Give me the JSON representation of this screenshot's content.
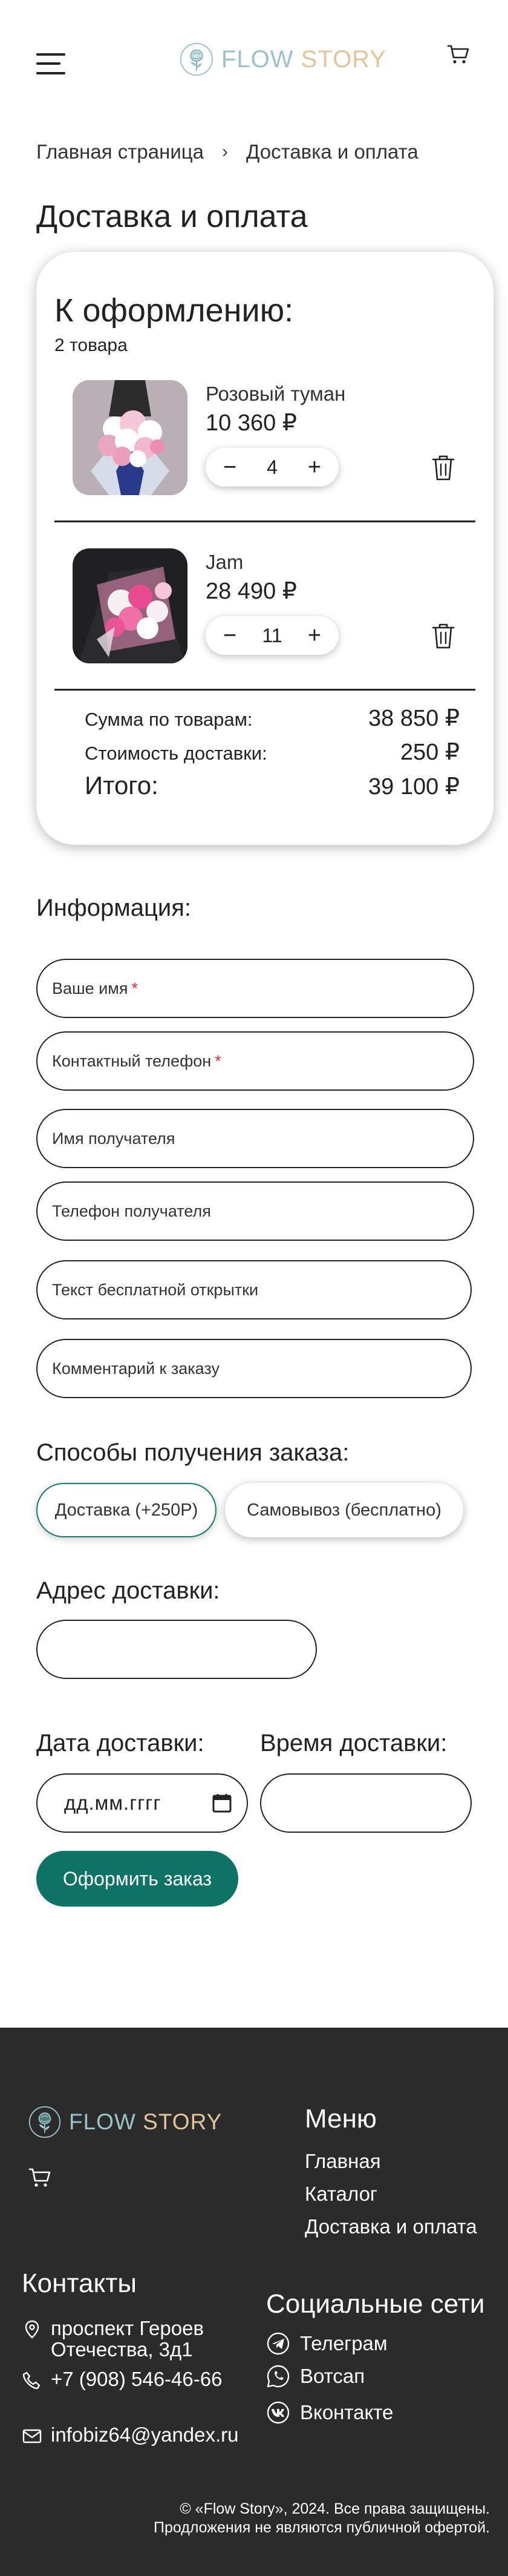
{
  "header": {
    "logo_word1": "FLOW",
    "logo_word2": "STORY"
  },
  "breadcrumb": {
    "home": "Главная страница",
    "separator": "›",
    "current": "Доставка и оплата"
  },
  "page_title": "Доставка и оплата",
  "cart": {
    "title": "К оформлению:",
    "count_label": "2 товара",
    "items": [
      {
        "name": "Розовый туман",
        "price": "10 360 ₽",
        "quantity": "4",
        "minus": "−",
        "plus": "+"
      },
      {
        "name": "Jam",
        "price": "28 490 ₽",
        "quantity": "11",
        "minus": "−",
        "plus": "+"
      }
    ],
    "totals": {
      "subtotal_label": "Сумма по товарам:",
      "subtotal_value": "38 850 ₽",
      "delivery_label": "Стоимость доставки:",
      "delivery_value": "250 ₽",
      "total_label": "Итого:",
      "total_value": "39 100 ₽"
    }
  },
  "form": {
    "info_title": "Информация:",
    "fields": {
      "name": "Ваше имя",
      "phone": "Контактный телефон",
      "recipient_name": "Имя получателя",
      "recipient_phone": "Телефон получателя",
      "card_text": "Текст бесплатной открытки",
      "comment": "Комментарий к заказу",
      "required_mark": "*"
    },
    "methods_title": "Способы получения заказа:",
    "method_delivery": "Доставка (+250Р)",
    "method_pickup": "Самовывоз (бесплатно)",
    "address_title": "Адрес доставки:",
    "date_title": "Дата доставки:",
    "date_placeholder": "дд.мм.гггг",
    "time_title": "Время доставки:",
    "submit": "Оформить заказ"
  },
  "footer": {
    "logo_word1": "FLOW",
    "logo_word2": "STORY",
    "menu_title": "Меню",
    "menu": [
      "Главная",
      "Каталог",
      "Доставка и оплата"
    ],
    "contacts_title": "Контакты",
    "address_line1": "проспект Героев",
    "address_line2": "Отечества, 3д1",
    "phone": "+7 (908) 546-46-66",
    "email": "infobiz64@yandex.ru",
    "social_title": "Социальные сети",
    "social": [
      "Телеграм",
      "Вотсап",
      "Вконтакте"
    ],
    "copyright_line1": "© «Flow Story», 2024. Все права защищены.",
    "copyright_line2": "Продложения не являются публичной офертой."
  },
  "colors": {
    "accent": "#0e7265",
    "logo_teal": "#9cc3c8",
    "logo_gold": "#e2c59b",
    "footer_bg": "#2b2b2b",
    "required": "#e03131"
  }
}
